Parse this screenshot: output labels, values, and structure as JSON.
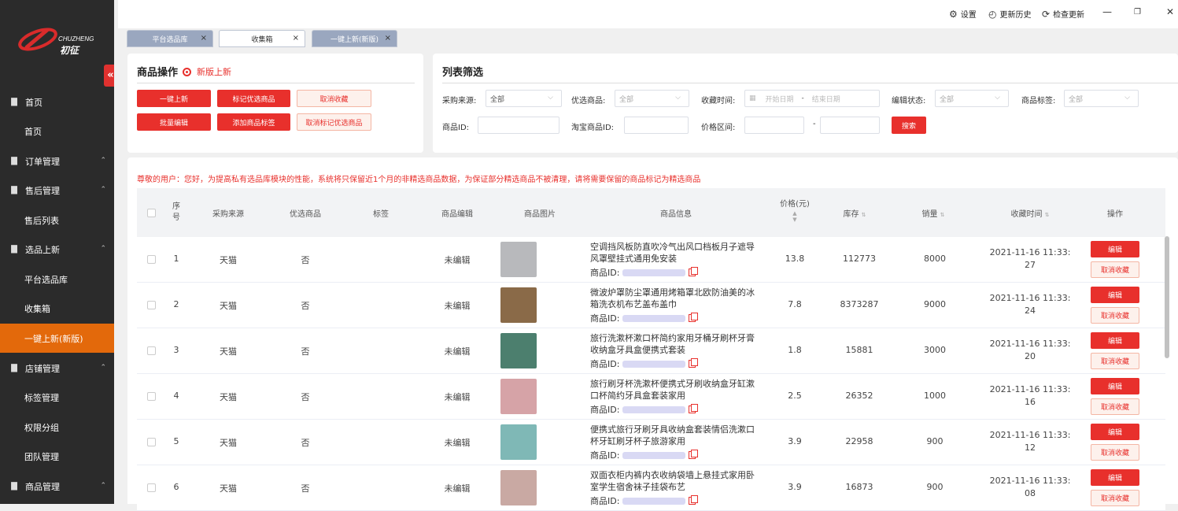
{
  "brand": {
    "name_en": "CHUZHENG",
    "name_cn": "初征"
  },
  "sidebar": {
    "collapse": "«",
    "items": [
      {
        "label": "首页",
        "type": "group",
        "icon": "bar-chart-icon"
      },
      {
        "label": "首页",
        "type": "sub"
      },
      {
        "label": "订单管理",
        "type": "group",
        "icon": "file-icon"
      },
      {
        "label": "售后管理",
        "type": "group",
        "icon": "list-icon"
      },
      {
        "label": "售后列表",
        "type": "sub"
      },
      {
        "label": "选品上新",
        "type": "group",
        "icon": "box-icon"
      },
      {
        "label": "平台选品库",
        "type": "sub"
      },
      {
        "label": "收集箱",
        "type": "sub"
      },
      {
        "label": "一键上新(新版)",
        "type": "sub",
        "active": true
      },
      {
        "label": "店铺管理",
        "type": "group",
        "icon": "store-icon"
      },
      {
        "label": "标签管理",
        "type": "sub"
      },
      {
        "label": "权限分组",
        "type": "sub"
      },
      {
        "label": "团队管理",
        "type": "sub"
      },
      {
        "label": "商品管理",
        "type": "group",
        "icon": "goods-icon"
      }
    ]
  },
  "topbar": {
    "settings": "设置",
    "history": "更新历史",
    "check_update": "检查更新",
    "minimize": "—",
    "restore": "❐",
    "close": "✕"
  },
  "tabs": [
    {
      "label": "平台选品库"
    },
    {
      "label": "收集箱"
    },
    {
      "label": "一键上新(新版)"
    }
  ],
  "ops": {
    "title": "商品操作",
    "new_label": "新版上新",
    "buttons": [
      "一键上新",
      "标记优选商品",
      "取消收藏",
      "批量编辑",
      "添加商品标签",
      "取消标记优选商品"
    ]
  },
  "filter": {
    "title": "列表筛选",
    "source_label": "采购来源:",
    "source_value": "全部",
    "preferred_label": "优选商品:",
    "preferred_value": "全部",
    "time_label": "收藏时间:",
    "start_placeholder": "开始日期",
    "dash": "-",
    "end_placeholder": "结束日期",
    "edit_label": "编辑状态:",
    "edit_value": "全部",
    "tag_label": "商品标签:",
    "tag_value": "全部",
    "product_id_label": "商品ID:",
    "taobao_id_label": "淘宝商品ID:",
    "price_label": "价格区间:",
    "search_button": "搜索"
  },
  "notice": "尊敬的用户：您好，为提高私有选品库模块的性能，系统将只保留近1个月的非精选商品数据，为保证部分精选商品不被清理，请将需要保留的商品标记为精选商品",
  "table": {
    "headers": {
      "index_a": "序",
      "index_b": "号",
      "source": "采购来源",
      "preferred": "优选商品",
      "tag": "标签",
      "edit": "商品编辑",
      "image": "商品图片",
      "info": "商品信息",
      "price": "价格(元)",
      "stock": "库存",
      "sales": "销量",
      "time": "收藏时间",
      "action": "操作"
    },
    "id_label": "商品ID:",
    "edit_btn": "编辑",
    "cancel_btn": "取消收藏",
    "rows": [
      {
        "idx": "1",
        "source": "天猫",
        "preferred": "否",
        "edit": "未编辑",
        "name": "空调挡风板防直吹冷气出风口档板月子遮导风罩壁挂式通用免安装",
        "price": "13.8",
        "stock": "112773",
        "sales": "8000",
        "time_a": "2021-11-16 11:33:",
        "time_b": "27",
        "img_color": "#b8b9bc"
      },
      {
        "idx": "2",
        "source": "天猫",
        "preferred": "否",
        "edit": "未编辑",
        "name": "微波炉罩防尘罩通用烤箱罩北欧防油美的冰箱洗衣机布艺盖布盖巾",
        "price": "7.8",
        "stock": "8373287",
        "sales": "9000",
        "time_a": "2021-11-16 11:33:",
        "time_b": "24",
        "img_color": "#8a6a48"
      },
      {
        "idx": "3",
        "source": "天猫",
        "preferred": "否",
        "edit": "未编辑",
        "name": "旅行洗漱杯漱口杯简约家用牙桶牙刷杯牙膏收纳盒牙具盒便携式套装",
        "price": "1.8",
        "stock": "15881",
        "sales": "3000",
        "time_a": "2021-11-16 11:33:",
        "time_b": "20",
        "img_color": "#4c7f6e"
      },
      {
        "idx": "4",
        "source": "天猫",
        "preferred": "否",
        "edit": "未编辑",
        "name": "旅行刷牙杯洗漱杯便携式牙刷收纳盒牙缸漱口杯简约牙具盒套装家用",
        "price": "2.5",
        "stock": "26352",
        "sales": "1000",
        "time_a": "2021-11-16 11:33:",
        "time_b": "16",
        "img_color": "#d6a3a7"
      },
      {
        "idx": "5",
        "source": "天猫",
        "preferred": "否",
        "edit": "未编辑",
        "name": "便携式旅行牙刷牙具收纳盒套装情侣洗漱口杯牙缸刷牙杯子旅游家用",
        "price": "3.9",
        "stock": "22958",
        "sales": "900",
        "time_a": "2021-11-16 11:33:",
        "time_b": "12",
        "img_color": "#7fb8b6"
      },
      {
        "idx": "6",
        "source": "天猫",
        "preferred": "否",
        "edit": "未编辑",
        "name": "双面衣柜内裤内衣收纳袋墙上悬挂式家用卧室学生宿舍袜子挂袋布艺",
        "price": "3.9",
        "stock": "16873",
        "sales": "900",
        "time_a": "2021-11-16 11:33:",
        "time_b": "08",
        "img_color": "#c9a9a3"
      }
    ]
  }
}
